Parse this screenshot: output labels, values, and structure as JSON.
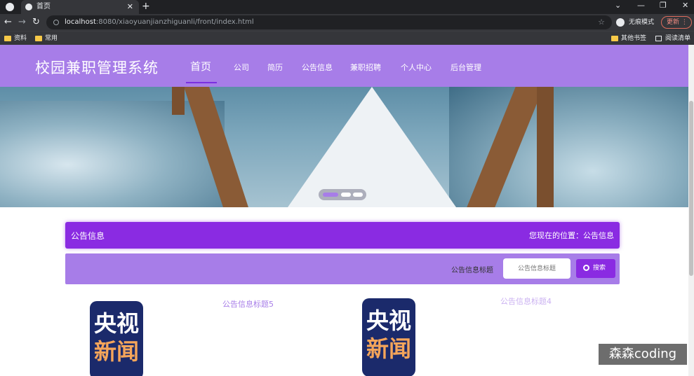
{
  "browser": {
    "tab_title": "首页",
    "url_host": "localhost",
    "url_rest": ":8080/xiaoyuanjianzhiguanli/front/index.html",
    "incognito_label": "无痕模式",
    "update_label": "更新",
    "bookmarks": [
      "资料",
      "常用"
    ],
    "bookmarks_right": [
      "其他书签",
      "阅读清单"
    ]
  },
  "navbar": {
    "brand": "校园兼职管理系统",
    "items": [
      "首页",
      "公司",
      "简历",
      "公告信息",
      "兼职招聘",
      "个人中心",
      "后台管理"
    ]
  },
  "section": {
    "title": "公告信息",
    "location": "您现在的位置：公告信息"
  },
  "search": {
    "label": "公告信息标题",
    "placeholder": "公告信息标题",
    "button": "搜索"
  },
  "cards": [
    {
      "image_top": "央视",
      "image_bottom": "新闻",
      "title": "公告信息标题5"
    },
    {
      "image_top": "央视",
      "image_bottom": "新闻",
      "title": "公告信息标题4"
    }
  ],
  "watermark": "森森coding"
}
